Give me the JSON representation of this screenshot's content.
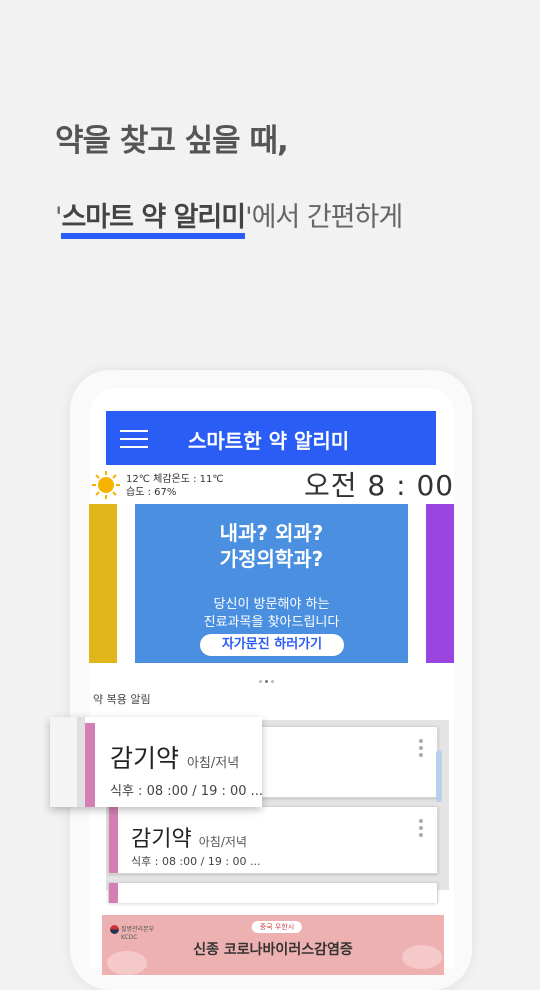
{
  "headline": {
    "line1": "약을 찾고 싶을 때,",
    "line2_open_quote": "'",
    "line2_highlight": "스마트 약 알리미",
    "line2_close_quote": "'",
    "line2_rest": "에서 간편하게"
  },
  "app": {
    "title": "스마트한 약 알리미"
  },
  "weather": {
    "icon": "sun-icon",
    "line1": "12℃ 체감온도 : 11℃",
    "line2": "습도 : 67%"
  },
  "clock": "오전 8 : 00",
  "banner": {
    "title_line1": "내과? 외과?",
    "title_line2": "가정의학과?",
    "desc_line1": "당신이 방문해야 하는",
    "desc_line2": "진료과목을 찾아드립니다",
    "button": "자가문진 하러가기",
    "carousel_active_index": 1,
    "carousel_count": 3
  },
  "section_label": "약 복용 알림",
  "medications": [
    {
      "name": "감기약",
      "period": "아침/저녁",
      "time": "식후 : 08 :00 / 19 : 00 ..."
    },
    {
      "name": "감기약",
      "period": "아침/저녁",
      "time": "식후 : 08 :00 / 19 : 00 ..."
    }
  ],
  "ad": {
    "org": "질병관리본부",
    "org_en": "KCDC",
    "badge": "중국 우한시",
    "title": "신종 코로나바이러스감염증"
  },
  "colors": {
    "accent": "#2a5cf6",
    "banner": "#4a8fe0",
    "card_left": "#e1b61b",
    "card_right": "#9b45e0",
    "pill_bar": "#d47fb4",
    "ad_bg": "#eeb1b1"
  }
}
